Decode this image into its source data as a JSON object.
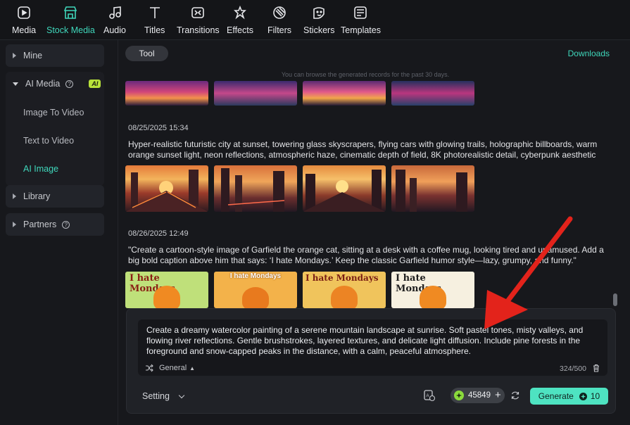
{
  "toolbar": {
    "items": [
      {
        "label": "Media",
        "icon": "media-icon"
      },
      {
        "label": "Stock Media",
        "icon": "stock-media-icon"
      },
      {
        "label": "Audio",
        "icon": "audio-icon"
      },
      {
        "label": "Titles",
        "icon": "titles-icon"
      },
      {
        "label": "Transitions",
        "icon": "transitions-icon"
      },
      {
        "label": "Effects",
        "icon": "effects-icon"
      },
      {
        "label": "Filters",
        "icon": "filters-icon"
      },
      {
        "label": "Stickers",
        "icon": "stickers-icon"
      },
      {
        "label": "Templates",
        "icon": "templates-icon"
      }
    ],
    "active": "Stock Media"
  },
  "sidebar": {
    "mine": "Mine",
    "ai_media": "AI Media",
    "ai_badge": "AI",
    "sub_items": [
      "Image To Video",
      "Text to Video",
      "AI Image"
    ],
    "active_sub": "AI Image",
    "library": "Library",
    "partners": "Partners"
  },
  "main": {
    "tab": "Tool",
    "downloads": "Downloads",
    "hint": "You can browse the generated records for the past 30 days.",
    "records": [
      {
        "timestamp": "08/25/2025 15:34",
        "prompt": "Hyper-realistic futuristic city at sunset, towering glass skyscrapers, flying cars with glowing trails, holographic billboards, warm orange sunset light, neon reflections, atmospheric haze, cinematic depth of field, 8K photorealistic detail, cyberpunk aesthetic"
      },
      {
        "timestamp": "08/26/2025 12:49",
        "prompt": "\"Create a cartoon-style image of Garfield the orange cat, sitting at a desk with a coffee mug, looking tired and unamused. Add a big bold caption above him that says: ‘I hate Mondays.’ Keep the classic Garfield humor style—lazy, grumpy, and funny.\"",
        "captions": [
          "I hate Mondays",
          "I hate Mondays",
          "I hate Mondays",
          "I hate Mondays"
        ]
      }
    ]
  },
  "composer": {
    "text": "Create a dreamy watercolor painting of a serene mountain landscape at sunrise. Soft pastel tones, misty valleys, and flowing river reflections. Gentle brushstrokes, layered textures, and delicate light diffusion. Include pine forests in the foreground and snow-capped peaks in the distance, with a calm, peaceful atmosphere.",
    "mode": "General",
    "counter": "324/500",
    "setting": "Setting",
    "credits": "45849",
    "generate": "Generate",
    "generate_cost": "10"
  },
  "colors": {
    "accent": "#3fd7bb",
    "generate_bg": "#4ee3c1",
    "arrow": "#e3231b",
    "badge": "#b8e23a"
  }
}
